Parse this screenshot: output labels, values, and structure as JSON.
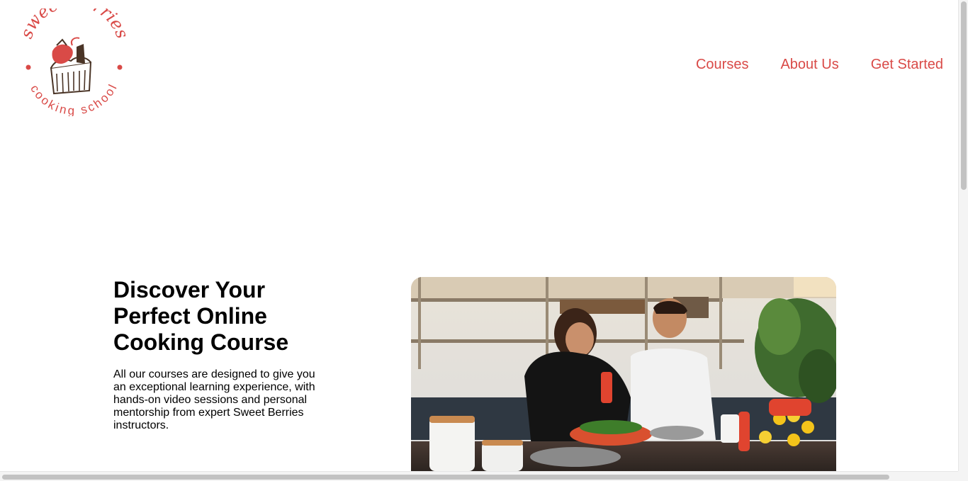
{
  "brand": {
    "top_text": "sweet berries",
    "bottom_text": "cooking school",
    "logo_icon": "cupcake-strawberry-icon",
    "accent_color": "#d94a47"
  },
  "nav": {
    "items": [
      {
        "label": "Courses"
      },
      {
        "label": "About Us"
      },
      {
        "label": "Get Started"
      }
    ]
  },
  "hero": {
    "title": "Discover Your Perfect Online Cooking Course",
    "description": "All our courses are designed to give you an exceptional learning experience, with hands-on video sessions and personal mentorship from expert Sweet Berries instructors."
  }
}
